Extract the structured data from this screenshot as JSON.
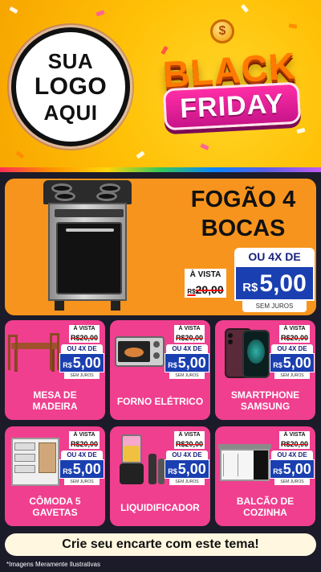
{
  "header": {
    "logo_lines": [
      "SUA",
      "LOGO",
      "AQUI"
    ],
    "badge_black": "BLACK",
    "badge_friday": "FRIDAY",
    "coin_symbol": "$"
  },
  "hero": {
    "title_line1": "FOGÃO 4",
    "title_line2": "BOCAS",
    "avista_label": "À VISTA",
    "old_price_prefix": "R$",
    "old_price": "20,00",
    "installment_label": "OU 4X DE",
    "currency": "R$",
    "price": "5,00",
    "interest_note": "SEM JUROS"
  },
  "products": [
    {
      "label_line1": "MESA DE",
      "label_line2": "MADEIRA",
      "avista_label": "À VISTA",
      "old_price": "R$20,00",
      "installment_label": "OU 4X DE",
      "currency": "R$",
      "price": "5,00",
      "interest_note": "SEM JUROS",
      "icon": "dining-table-icon"
    },
    {
      "label_line1": "FORNO ELÉTRICO",
      "label_line2": "",
      "avista_label": "À VISTA",
      "old_price": "R$20,00",
      "installment_label": "OU 4X DE",
      "currency": "R$",
      "price": "5,00",
      "interest_note": "SEM JUROS",
      "icon": "electric-oven-icon"
    },
    {
      "label_line1": "SMARTPHONE",
      "label_line2": "SAMSUNG",
      "avista_label": "À VISTA",
      "old_price": "R$20,00",
      "installment_label": "OU 4X DE",
      "currency": "R$",
      "price": "5,00",
      "interest_note": "SEM JUROS",
      "icon": "smartphone-icon"
    },
    {
      "label_line1": "CÔMODA 5",
      "label_line2": "GAVETAS",
      "avista_label": "À VISTA",
      "old_price": "R$20,00",
      "installment_label": "OU 4X DE",
      "currency": "R$",
      "price": "5,00",
      "interest_note": "SEM JUROS",
      "icon": "dresser-icon"
    },
    {
      "label_line1": "LIQUIDIFICADOR",
      "label_line2": "",
      "avista_label": "À VISTA",
      "old_price": "R$20,00",
      "installment_label": "OU 4X DE",
      "currency": "R$",
      "price": "5,00",
      "interest_note": "SEM JUROS",
      "icon": "blender-icon"
    },
    {
      "label_line1": "BALCÃO DE",
      "label_line2": "COZINHA",
      "avista_label": "À VISTA",
      "old_price": "R$20,00",
      "installment_label": "OU 4X DE",
      "currency": "R$",
      "price": "5,00",
      "interest_note": "SEM JUROS",
      "icon": "kitchen-cabinet-icon"
    }
  ],
  "footer": {
    "cta": "Crie seu encarte com este tema!",
    "disclaimer": "*Imagens Meramente Ilustrativas"
  },
  "colors": {
    "header_yellow": "#ffc107",
    "hero_orange": "#f7941d",
    "card_pink": "#ef3f8e",
    "price_blue": "#1a3fb0",
    "background": "#1b1b2a"
  }
}
